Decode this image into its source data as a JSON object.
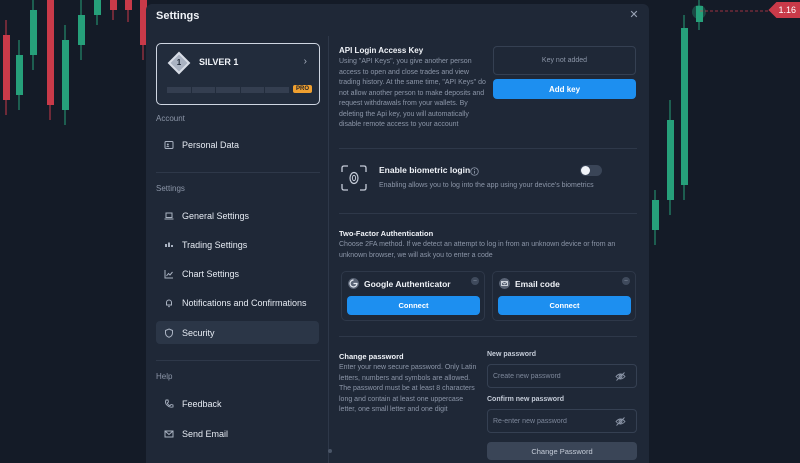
{
  "background": {
    "price_label": "1.16",
    "candle_bull_color": "#26a07a",
    "candle_bear_color": "#c93a49"
  },
  "modal": {
    "title": "Settings",
    "close_icon": "close-icon"
  },
  "profile": {
    "level_number": "1",
    "level_name": "SILVER 1",
    "badge": "PRO",
    "progress_fraction": 0
  },
  "sidebar": {
    "sections": [
      {
        "label": "Account",
        "items": [
          {
            "label": "Personal Data",
            "icon": "id-card-icon"
          }
        ]
      },
      {
        "label": "Settings",
        "items": [
          {
            "label": "General Settings",
            "icon": "laptop-icon"
          },
          {
            "label": "Trading Settings",
            "icon": "trading-icon"
          },
          {
            "label": "Chart Settings",
            "icon": "chart-icon"
          },
          {
            "label": "Notifications and Confirmations",
            "icon": "bell-icon"
          },
          {
            "label": "Security",
            "icon": "shield-icon",
            "active": true
          }
        ]
      },
      {
        "label": "Help",
        "items": [
          {
            "label": "Feedback",
            "icon": "phone-icon"
          },
          {
            "label": "Send Email",
            "icon": "mail-icon"
          }
        ]
      }
    ]
  },
  "api_key": {
    "title": "API Login Access Key",
    "description": "Using \"API Keys\", you give another person access to open and close trades and view trading history. At the same time, \"API Keys\" do not allow another person to make deposits and request withdrawals from your wallets. By deleting the Api key, you will automatically disable remote access to your account",
    "status": "Key not added",
    "add_label": "Add key"
  },
  "biometric": {
    "title": "Enable biometric login",
    "description": "Enabling allows you to log into the app using your device's biometrics",
    "enabled": false
  },
  "two_factor": {
    "title": "Two-Factor Authentication",
    "description": "Choose 2FA method. If we detect an attempt to log in from an unknown device or from an unknown browser, we will ask you to enter a code",
    "methods": [
      {
        "name": "Google Authenticator",
        "connect_label": "Connect"
      },
      {
        "name": "Email code",
        "connect_label": "Connect"
      }
    ]
  },
  "change_password": {
    "title": "Change password",
    "description": "Enter your new secure password. Only Latin letters, numbers and symbols are allowed. The password must be at least 8 characters long and contain at least one uppercase letter, one small letter and one digit",
    "new_label": "New password",
    "new_placeholder": "Create new password",
    "confirm_label": "Confirm new password",
    "confirm_placeholder": "Re-enter new password",
    "submit_label": "Change Password"
  }
}
